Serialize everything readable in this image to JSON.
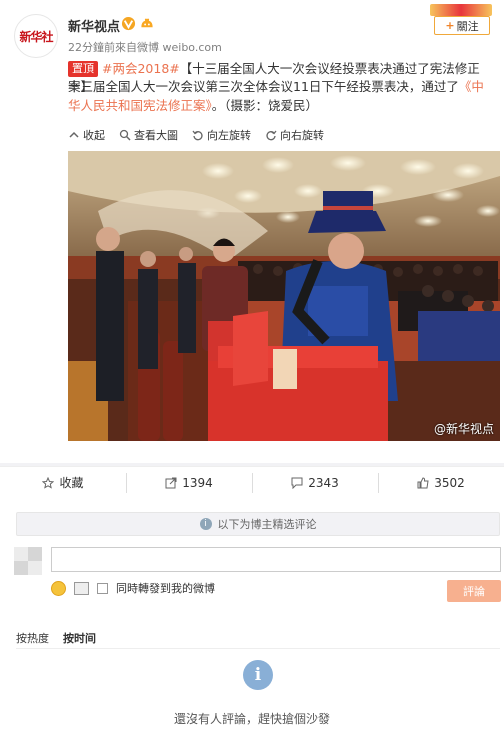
{
  "post": {
    "user_name": "新华视点",
    "avatar_text": "新华社",
    "time": "22分鐘前",
    "source_prefix": "來自",
    "source": "微博 weibo.com",
    "follow_label": "關注",
    "badge": "置頂",
    "topic": "#两会2018#",
    "headline": "【十三届全国人大一次会议经投票表决通过了宪法修正案】",
    "body_before": "十三届全国人大一次会议第三次全体会议11日下午经投票表决，通过了",
    "body_quote": "《中华人民共和国宪法修正案》",
    "body_after": "。（摄影：饶爱民）",
    "watermark": "@新华视点"
  },
  "image_tools": {
    "collapse": "收起",
    "view_large": "查看大圖",
    "rotate_left": "向左旋转",
    "rotate_right": "向右旋转"
  },
  "actions": {
    "favorite": "收藏",
    "repost": "1394",
    "comment": "2343",
    "like": "3502"
  },
  "comments": {
    "hint": "以下为博主精选评论",
    "input_value": "",
    "also_repost": "同時轉發到我的微博",
    "submit": "評論",
    "sort_hot": "按热度",
    "sort_time": "按时间",
    "empty": "還沒有人評論，趕快搶個沙發"
  },
  "colors": {
    "accent": "#eb7350",
    "badge": "#e5332c",
    "submit": "#f7b08f"
  }
}
